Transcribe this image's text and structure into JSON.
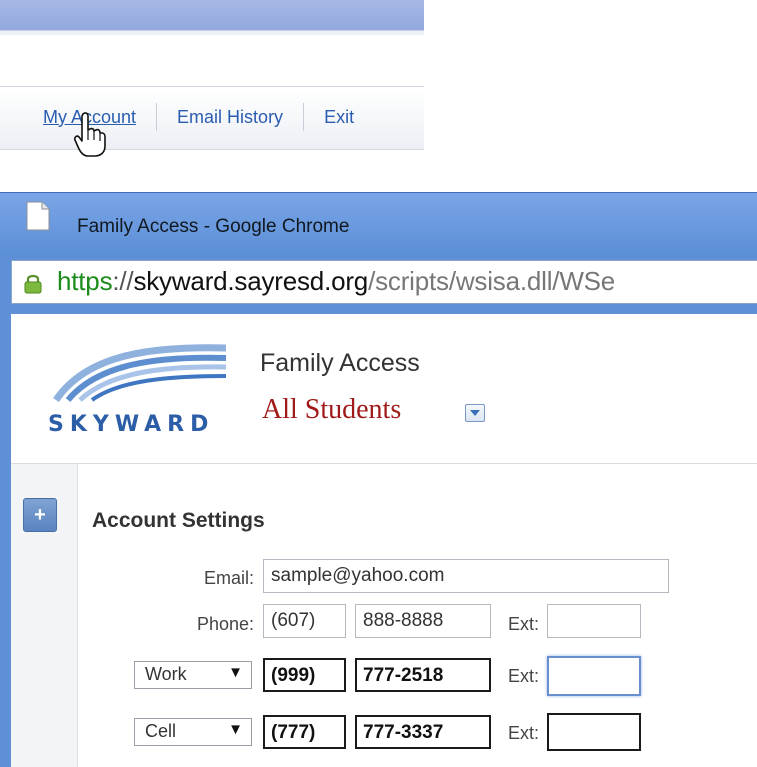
{
  "nav": {
    "items": [
      "My Account",
      "Email History",
      "Exit"
    ]
  },
  "window": {
    "title": "Family Access - Google Chrome",
    "url": {
      "scheme": "https",
      "separator": "://",
      "host": "skyward.sayresd.org",
      "path": "/scripts/wsisa.dll/WSe"
    }
  },
  "app": {
    "logo_text": "SKYWARD",
    "title": "Family Access",
    "student_selector": "All Students"
  },
  "account_settings": {
    "heading": "Account Settings",
    "email_label": "Email:",
    "email_value": "sample@yahoo.com",
    "phone_label": "Phone:",
    "phone": {
      "area": "(607)",
      "number": "888-8888",
      "ext_label": "Ext:",
      "ext": ""
    },
    "phones": [
      {
        "type": "Work",
        "area": "(999)",
        "number": "777-2518",
        "ext_label": "Ext:",
        "ext": ""
      },
      {
        "type": "Cell",
        "area": "(777)",
        "number": "777-3337",
        "ext_label": "Ext:",
        "ext": ""
      }
    ]
  },
  "colors": {
    "link": "#2a5db0",
    "chrome_title": "#5b8ed6",
    "students_text": "#a11a1a",
    "url_scheme": "#1c8c1c"
  }
}
